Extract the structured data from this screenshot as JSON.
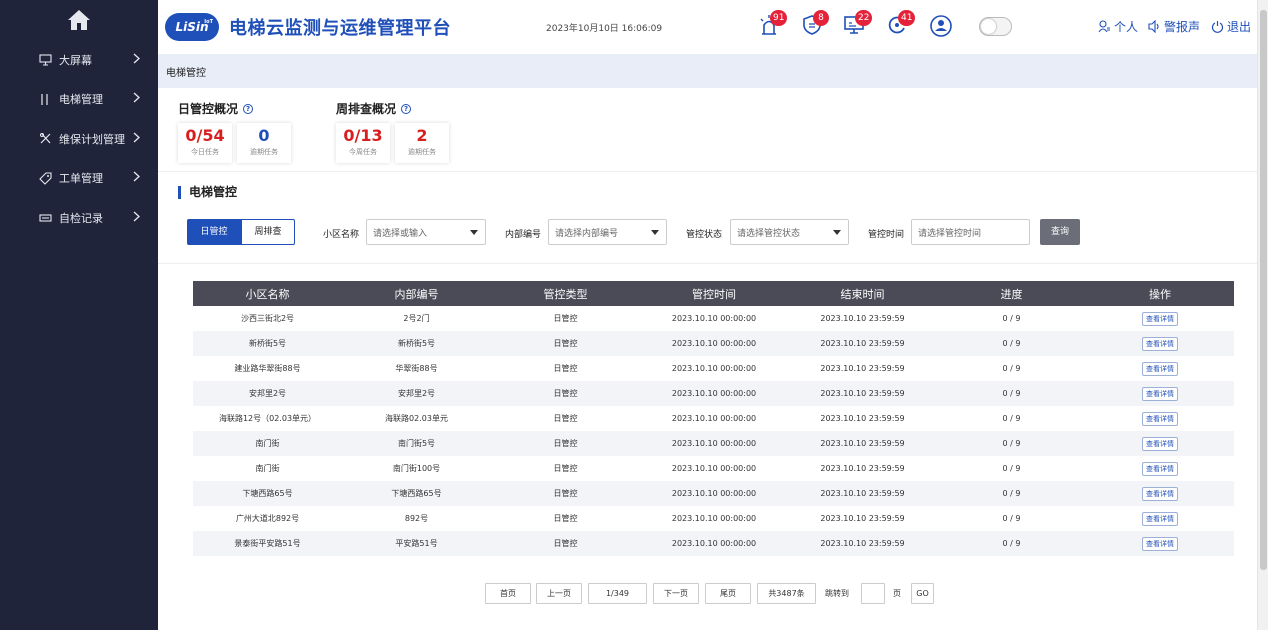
{
  "app": {
    "title": "电梯云监测与运维管理平台",
    "logo_text": "LiSin",
    "logo_sup": "IoT",
    "datetime": "2023年10月10日 16:06:09"
  },
  "header_icons": [
    {
      "icon": "alarm-icon",
      "badge": "91"
    },
    {
      "icon": "inspection-shield-icon",
      "badge": "8"
    },
    {
      "icon": "monitor-icon",
      "badge": "22"
    },
    {
      "icon": "refresh-cycle-icon",
      "badge": "41"
    },
    {
      "icon": "user-circle-icon",
      "badge": ""
    }
  ],
  "header_links": {
    "personal": "个人",
    "alarm_report": "警报声",
    "logout": "退出"
  },
  "sidebar": {
    "items": [
      {
        "label": "大屏幕",
        "icon": "monitor-icon"
      },
      {
        "label": "电梯管理",
        "icon": "elevator-icon"
      },
      {
        "label": "维保计划管理",
        "icon": "tools-icon"
      },
      {
        "label": "工单管理",
        "icon": "tag-icon"
      },
      {
        "label": "自检记录",
        "icon": "printer-icon"
      }
    ]
  },
  "breadcrumb": "电梯管控",
  "summary": {
    "daily": {
      "title": "日管控概况",
      "cards": [
        {
          "value": "0/54",
          "label": "今日任务",
          "color": "#d81e1e"
        },
        {
          "value": "0",
          "label": "逾期任务",
          "color": "#1f4fb8"
        }
      ]
    },
    "weekly": {
      "title": "周排查概况",
      "cards": [
        {
          "value": "0/13",
          "label": "今周任务",
          "color": "#d81e1e"
        },
        {
          "value": "2",
          "label": "逾期任务",
          "color": "#d81e1e"
        }
      ]
    }
  },
  "section_title": "电梯管控",
  "filters": {
    "tabs": [
      "日管控",
      "周排查"
    ],
    "community_label": "小区名称",
    "community_placeholder": "请选择或输入",
    "code_label": "内部编号",
    "code_placeholder": "请选择内部编号",
    "status_label": "管控状态",
    "status_placeholder": "请选择管控状态",
    "time_label": "管控时间",
    "time_placeholder": "请选择管控时间",
    "query_button": "查询"
  },
  "table": {
    "headers": [
      "小区名称",
      "内部编号",
      "管控类型",
      "管控时间",
      "结束时间",
      "进度",
      "操作"
    ],
    "rows": [
      [
        "沙西三街北2号",
        "2号2门",
        "日管控",
        "2023.10.10 00:00:00",
        "2023.10.10 23:59:59",
        "0 / 9",
        "查看详情"
      ],
      [
        "新桥街5号",
        "新桥街5号",
        "日管控",
        "2023.10.10 00:00:00",
        "2023.10.10 23:59:59",
        "0 / 9",
        "查看详情"
      ],
      [
        "建业路华翠街88号",
        "华翠街88号",
        "日管控",
        "2023.10.10 00:00:00",
        "2023.10.10 23:59:59",
        "0 / 9",
        "查看详情"
      ],
      [
        "安邦里2号",
        "安邦里2号",
        "日管控",
        "2023.10.10 00:00:00",
        "2023.10.10 23:59:59",
        "0 / 9",
        "查看详情"
      ],
      [
        "海联路12号（02.03单元）",
        "海联路02.03单元",
        "日管控",
        "2023.10.10 00:00:00",
        "2023.10.10 23:59:59",
        "0 / 9",
        "查看详情"
      ],
      [
        "南门街",
        "南门街5号",
        "日管控",
        "2023.10.10 00:00:00",
        "2023.10.10 23:59:59",
        "0 / 9",
        "查看详情"
      ],
      [
        "南门街",
        "南门街100号",
        "日管控",
        "2023.10.10 00:00:00",
        "2023.10.10 23:59:59",
        "0 / 9",
        "查看详情"
      ],
      [
        "下塘西路65号",
        "下塘西路65号",
        "日管控",
        "2023.10.10 00:00:00",
        "2023.10.10 23:59:59",
        "0 / 9",
        "查看详情"
      ],
      [
        "广州大道北892号",
        "892号",
        "日管控",
        "2023.10.10 00:00:00",
        "2023.10.10 23:59:59",
        "0 / 9",
        "查看详情"
      ],
      [
        "景泰街平安路51号",
        "平安路51号",
        "日管控",
        "2023.10.10 00:00:00",
        "2023.10.10 23:59:59",
        "0 / 9",
        "查看详情"
      ]
    ]
  },
  "pagination": {
    "first": "首页",
    "prev": "上一页",
    "page": "1/349",
    "next": "下一页",
    "last": "尾页",
    "total": "共3487条",
    "jump_label": "跳转到",
    "jump_value": "",
    "page_unit": "页",
    "go": "GO"
  }
}
